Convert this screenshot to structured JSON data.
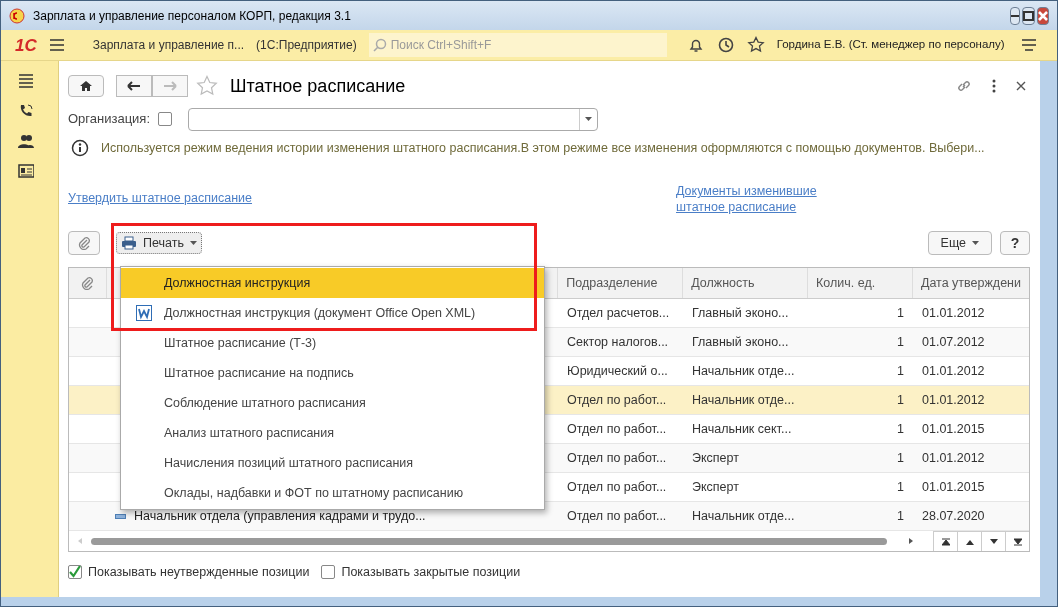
{
  "window": {
    "title": "Зарплата и управление персоналом КОРП, редакция 3.1"
  },
  "app_bar": {
    "logo": "1С",
    "title": "Зарплата и управление п...",
    "platform": "(1С:Предприятие)",
    "search_placeholder": "Поиск Ctrl+Shift+F",
    "user": "Гордина Е.В. (Ст. менеджер по персоналу)"
  },
  "form": {
    "title": "Штатное расписание",
    "organization": {
      "label": "Организация:",
      "checked": false
    },
    "info": "Используется режим ведения истории изменения штатного расписания.В этом режиме все изменения оформляются с помощью документов. Выбери...",
    "links": [
      "Утвердить штатное расписание",
      "Документы изменившие штатное расписание"
    ],
    "print_button": "Печать",
    "more_button": "Еще",
    "help_button": "?",
    "print_menu": [
      {
        "label": "Должностная инструкция",
        "kind": "plain",
        "selected": true
      },
      {
        "label": "Должностная инструкция (документ Office Open XML)",
        "kind": "word",
        "selected": false
      },
      {
        "label": "Штатное расписание (Т-3)",
        "kind": "plain",
        "selected": false
      },
      {
        "label": "Штатное расписание на подпись",
        "kind": "plain",
        "selected": false
      },
      {
        "label": "Соблюдение штатного расписания",
        "kind": "plain",
        "selected": false
      },
      {
        "label": "Анализ штатного расписания",
        "kind": "plain",
        "selected": false
      },
      {
        "label": "Начисления позиций штатного расписания",
        "kind": "plain",
        "selected": false
      },
      {
        "label": "Оклады, надбавки и ФОТ по штатному расписанию",
        "kind": "plain",
        "selected": false
      }
    ],
    "table": {
      "columns": [
        "Подразделение",
        "Должность",
        "Колич. ед.",
        "Дата утверждени"
      ],
      "rows": [
        {
          "department": "Отдел расчетов...",
          "position": "Главный эконо...",
          "count": "1",
          "date": "01.01.2012",
          "selected": false
        },
        {
          "department": "Сектор налогов...",
          "position": "Главный эконо...",
          "count": "1",
          "date": "01.07.2012",
          "selected": false
        },
        {
          "department": "Юридический о...",
          "position": "Начальник отде...",
          "count": "1",
          "date": "01.01.2012",
          "selected": false
        },
        {
          "department": "Отдел по работ...",
          "position": "Начальник отде...",
          "count": "1",
          "date": "01.01.2012",
          "selected": true
        },
        {
          "department": "Отдел по работ...",
          "position": "Начальник сект...",
          "count": "1",
          "date": "01.01.2015",
          "selected": false
        },
        {
          "department": "Отдел по работ...",
          "position": "Эксперт",
          "count": "1",
          "date": "01.01.2012",
          "selected": false
        },
        {
          "department": "Отдел по работ...",
          "position": "Эксперт",
          "count": "1",
          "date": "01.01.2015",
          "selected": false
        },
        {
          "name": "Начальник отдела (управления кадрами и трудо...",
          "department": "Отдел по работ...",
          "position": "Начальник отде...",
          "count": "1",
          "date": "28.07.2020",
          "selected": false
        }
      ]
    },
    "options": [
      {
        "label": "Показывать неутвержденные позиции",
        "checked": true
      },
      {
        "label": "Показывать закрытые позиции",
        "checked": false
      }
    ]
  }
}
